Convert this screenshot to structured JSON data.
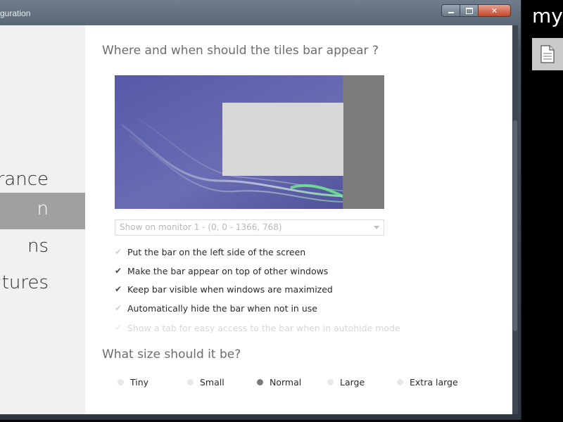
{
  "window": {
    "title": "guration",
    "controls": {
      "minimize": "minimize",
      "maximize": "maximize",
      "close": "✕"
    }
  },
  "sidebar": {
    "items": [
      {
        "label": "rance",
        "active": false
      },
      {
        "label": "n",
        "active": true
      },
      {
        "label": "ns",
        "active": false
      },
      {
        "label": "eatures",
        "active": false
      }
    ]
  },
  "main": {
    "placement_heading": "Where and when should the tiles bar appear ?",
    "monitor_select": {
      "value": "Show on monitor 1 - (0, 0 - 1366, 768)"
    },
    "options": [
      {
        "label": "Put the bar on the left side of the screen",
        "checked": false,
        "enabled": true
      },
      {
        "label": "Make the bar appear on top of other windows",
        "checked": true,
        "enabled": true
      },
      {
        "label": "Keep bar visible when windows are maximized",
        "checked": true,
        "enabled": true
      },
      {
        "label": "Automatically hide the bar when not in use",
        "checked": false,
        "enabled": true
      },
      {
        "label": "Show a tab for easy access to the bar when in autohide mode",
        "checked": false,
        "enabled": false
      }
    ],
    "size_heading": "What size should it be?",
    "sizes": [
      {
        "label": "Tiny",
        "selected": false
      },
      {
        "label": "Small",
        "selected": false
      },
      {
        "label": "Normal",
        "selected": true
      },
      {
        "label": "Large",
        "selected": false
      },
      {
        "label": "Extra large",
        "selected": false
      }
    ]
  },
  "side_app": {
    "text": "my",
    "tile_icon": "document-icon"
  },
  "colors": {
    "sidebar_bg": "#f1f1f1",
    "sidebar_active": "#a0a0a0",
    "tiles_bar": "#7b7b7b",
    "wallpaper": "#55579c"
  }
}
